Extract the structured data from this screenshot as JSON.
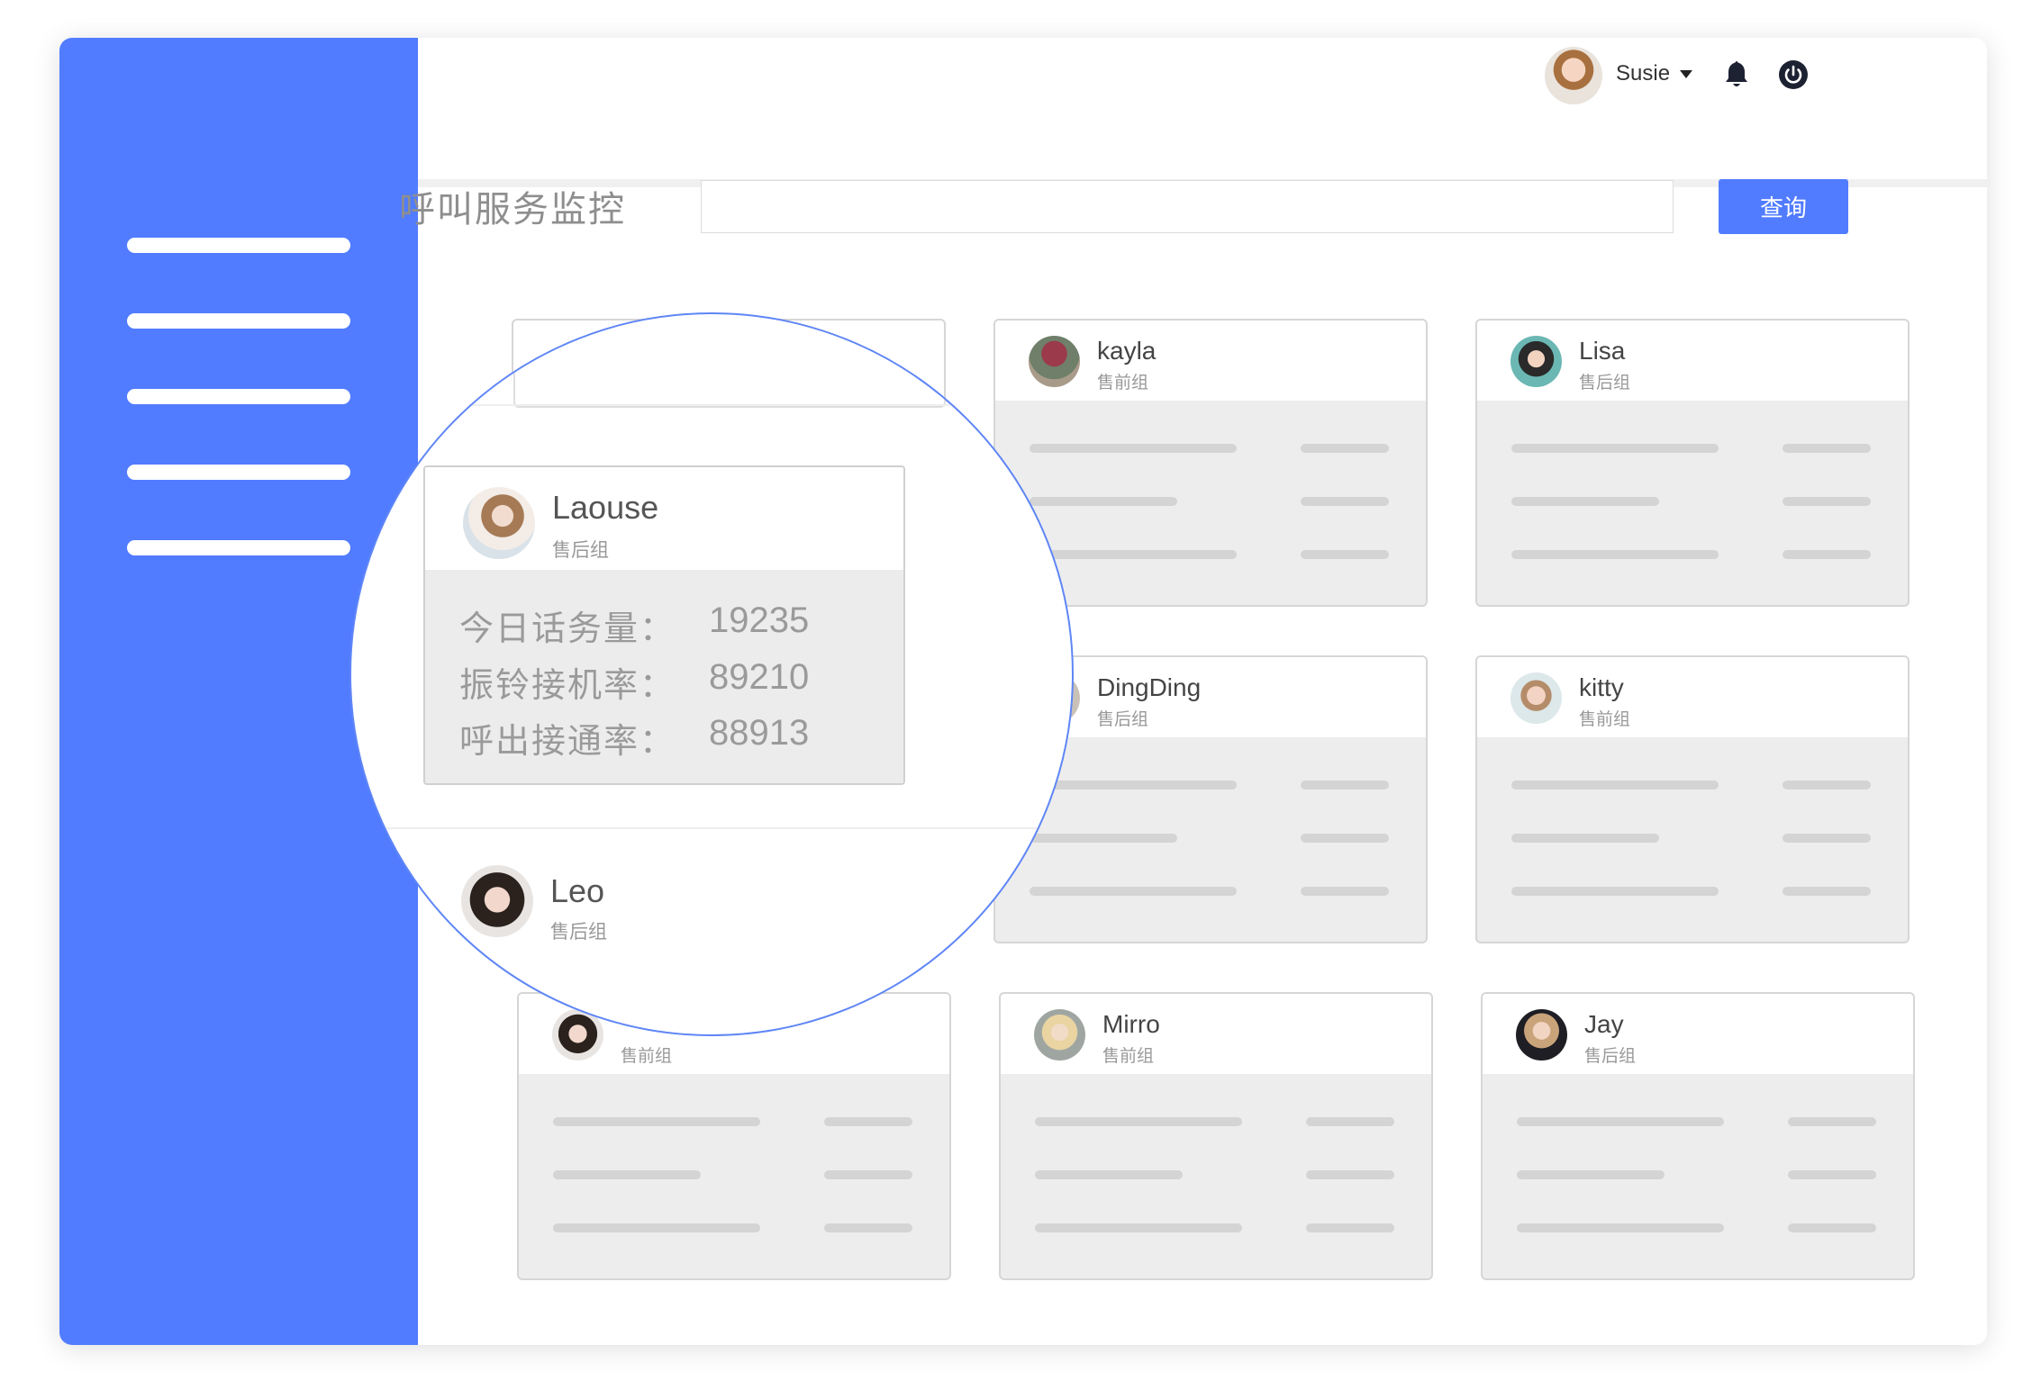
{
  "header": {
    "user_name": "Susie"
  },
  "page": {
    "title": "呼叫服务监控",
    "search_value": "",
    "query_label": "查询"
  },
  "cards": [
    {
      "name": "kayla",
      "group": "售前组"
    },
    {
      "name": "Lisa",
      "group": "售后组"
    },
    {
      "name": "DingDing",
      "group": "售后组"
    },
    {
      "name": "kitty",
      "group": "售前组"
    },
    {
      "name": "Mirro",
      "group": "售前组"
    },
    {
      "name": "Jay",
      "group": "售后组"
    },
    {
      "name": "",
      "group": "售前组"
    }
  ],
  "zoom": {
    "card": {
      "name": "Laouse",
      "group": "售后组",
      "stats": [
        {
          "label": "今日话务量：",
          "value": "19235"
        },
        {
          "label": "振铃接机率：",
          "value": "89210"
        },
        {
          "label": "呼出接通率：",
          "value": "88913"
        }
      ]
    },
    "leo": {
      "name": "Leo",
      "group": "售后组"
    }
  },
  "icons": {
    "bell": "bell-icon",
    "power": "power-icon",
    "caret": "caret-down-icon"
  },
  "colors": {
    "accent": "#517cff",
    "card_body": "#ededed",
    "placeholder_bar": "#d4d4d4"
  }
}
